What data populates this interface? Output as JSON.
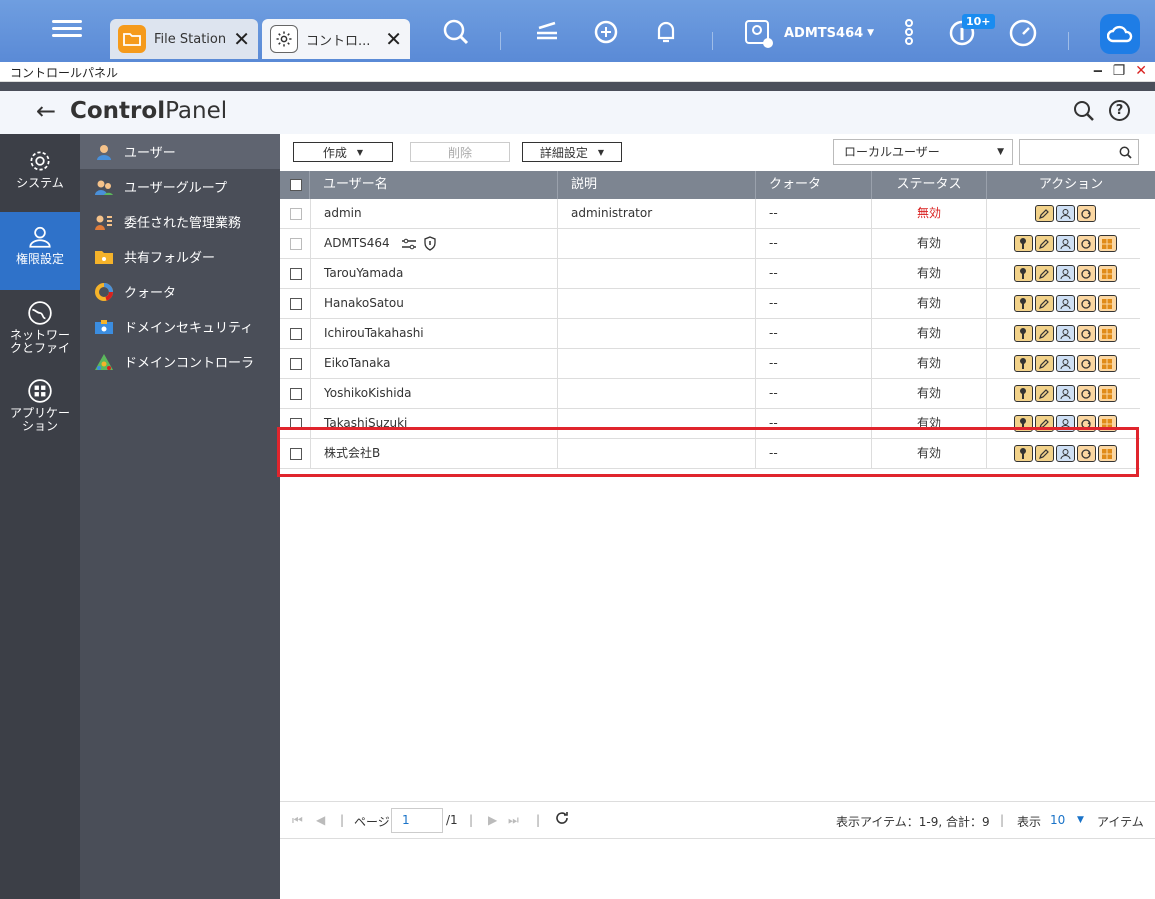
{
  "topbar": {
    "tabs": [
      {
        "label": "File Station"
      },
      {
        "label": "コントロ..."
      }
    ],
    "user_name": "ADMTS464",
    "notification_badge": "10+"
  },
  "window": {
    "title": "コントロールパネル",
    "min": "‒",
    "restore": "❐",
    "close": "✕"
  },
  "header": {
    "title_bold": "Control",
    "title_rest": "Panel"
  },
  "sidebar": {
    "items": [
      {
        "label": "システム"
      },
      {
        "label": "権限設定"
      },
      {
        "label1": "ネットワー",
        "label2": "クとファイ"
      },
      {
        "label1": "アプリケー",
        "label2": "ション"
      }
    ]
  },
  "subnav": {
    "items": [
      {
        "label": "ユーザー"
      },
      {
        "label": "ユーザーグループ"
      },
      {
        "label": "委任された管理業務"
      },
      {
        "label": "共有フォルダー"
      },
      {
        "label": "クォータ"
      },
      {
        "label": "ドメインセキュリティ"
      },
      {
        "label": "ドメインコントローラ"
      }
    ]
  },
  "toolbar": {
    "create": "作成",
    "delete": "削除",
    "advanced": "詳細設定",
    "user_type": "ローカルユーザー"
  },
  "table": {
    "headers": {
      "name": "ユーザー名",
      "desc": "説明",
      "quota": "クォータ",
      "status": "ステータス",
      "action": "アクション"
    },
    "rows": [
      {
        "name": "admin",
        "desc": "administrator",
        "quota": "--",
        "status": "無効"
      },
      {
        "name": "ADMTS464",
        "desc": "",
        "quota": "--",
        "status": "有効"
      },
      {
        "name": "TarouYamada",
        "desc": "",
        "quota": "--",
        "status": "有効"
      },
      {
        "name": "HanakoSatou",
        "desc": "",
        "quota": "--",
        "status": "有効"
      },
      {
        "name": "IchirouTakahashi",
        "desc": "",
        "quota": "--",
        "status": "有効"
      },
      {
        "name": "EikoTanaka",
        "desc": "",
        "quota": "--",
        "status": "有効"
      },
      {
        "name": "YoshikoKishida",
        "desc": "",
        "quota": "--",
        "status": "有効"
      },
      {
        "name": "TakashiSuzuki",
        "desc": "",
        "quota": "--",
        "status": "有効"
      },
      {
        "name": "株式会社B",
        "desc": "",
        "quota": "--",
        "status": "有効"
      }
    ]
  },
  "pager": {
    "page_label": "ページ",
    "page_value": "1",
    "page_total": "/1",
    "display_items": "表示アイテム：1-9, 合計：9",
    "show_label": "表示",
    "per_page": "10",
    "items_label": "アイテム"
  },
  "colors": {
    "accent": "#2f72c9",
    "highlight": "#e0252d",
    "disabled_status": "#d9201f"
  }
}
